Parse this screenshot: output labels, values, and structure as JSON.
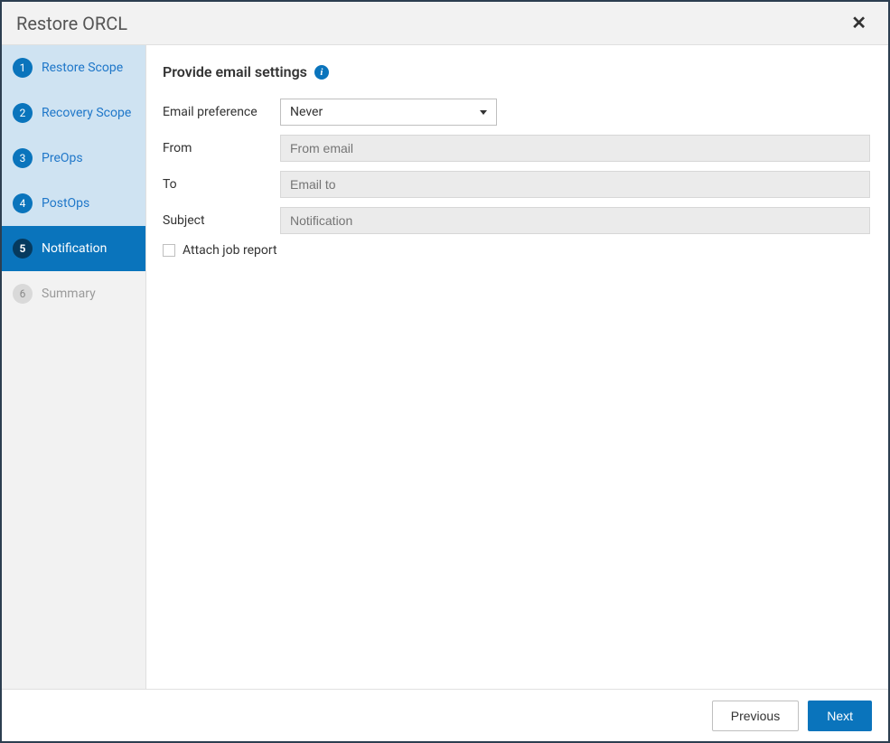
{
  "header": {
    "title": "Restore ORCL"
  },
  "sidebar": {
    "steps": [
      {
        "num": "1",
        "label": "Restore Scope",
        "state": "completed"
      },
      {
        "num": "2",
        "label": "Recovery Scope",
        "state": "completed"
      },
      {
        "num": "3",
        "label": "PreOps",
        "state": "completed"
      },
      {
        "num": "4",
        "label": "PostOps",
        "state": "completed"
      },
      {
        "num": "5",
        "label": "Notification",
        "state": "active"
      },
      {
        "num": "6",
        "label": "Summary",
        "state": "pending"
      }
    ]
  },
  "content": {
    "section_title": "Provide email settings",
    "fields": {
      "email_pref": {
        "label": "Email preference",
        "value": "Never"
      },
      "from": {
        "label": "From",
        "placeholder": "From email",
        "value": ""
      },
      "to": {
        "label": "To",
        "placeholder": "Email to",
        "value": ""
      },
      "subject": {
        "label": "Subject",
        "placeholder": "Notification",
        "value": ""
      }
    },
    "attach_label": "Attach job report",
    "attach_checked": false
  },
  "footer": {
    "previous": "Previous",
    "next": "Next"
  }
}
